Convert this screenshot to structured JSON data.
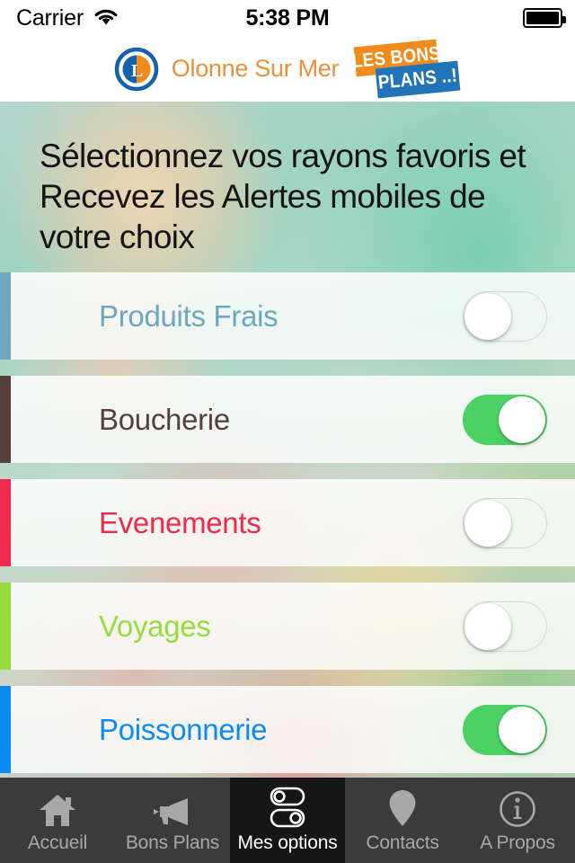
{
  "status_bar": {
    "carrier": "Carrier",
    "wifi_icon": "wifi-icon",
    "time": "5:38 PM",
    "battery_icon": "battery-full-icon"
  },
  "header": {
    "logo_icon": "leclerc-logo",
    "store_name": "Olonne Sur Mer",
    "badge_line1": "LES BONS",
    "badge_line2": "PLANS ..!",
    "badge_color_1": "#EF8C1C",
    "badge_color_2": "#2274B8",
    "store_name_color": "#E8913A"
  },
  "main": {
    "headline": "Sélectionnez vos rayons favoris et Recevez les Alertes mobiles de votre choix",
    "rows": [
      {
        "label": "Produits Frais",
        "text_color": "#6FA8BE",
        "stripe_color": "#6FA8BE",
        "enabled": false
      },
      {
        "label": "Boucherie",
        "text_color": "#56403C",
        "stripe_color": "#56403C",
        "enabled": true
      },
      {
        "label": "Evenements",
        "text_color": "#EE2B4C",
        "stripe_color": "#EE2B4C",
        "enabled": false
      },
      {
        "label": "Voyages",
        "text_color": "#96DC3C",
        "stripe_color": "#96DC3C",
        "enabled": false
      },
      {
        "label": "Poissonnerie",
        "text_color": "#0A8BF5",
        "stripe_color": "#0A8BF5",
        "enabled": true
      }
    ],
    "toggle_on_color": "#4BD263"
  },
  "tabbar": {
    "active_index": 2,
    "items": [
      {
        "label": "Accueil",
        "icon": "home-icon"
      },
      {
        "label": "Bons Plans",
        "icon": "megaphone-icon"
      },
      {
        "label": "Mes options",
        "icon": "toggles-icon"
      },
      {
        "label": "Contacts",
        "icon": "map-pin-icon"
      },
      {
        "label": "A Propos",
        "icon": "info-circle-icon"
      }
    ]
  }
}
